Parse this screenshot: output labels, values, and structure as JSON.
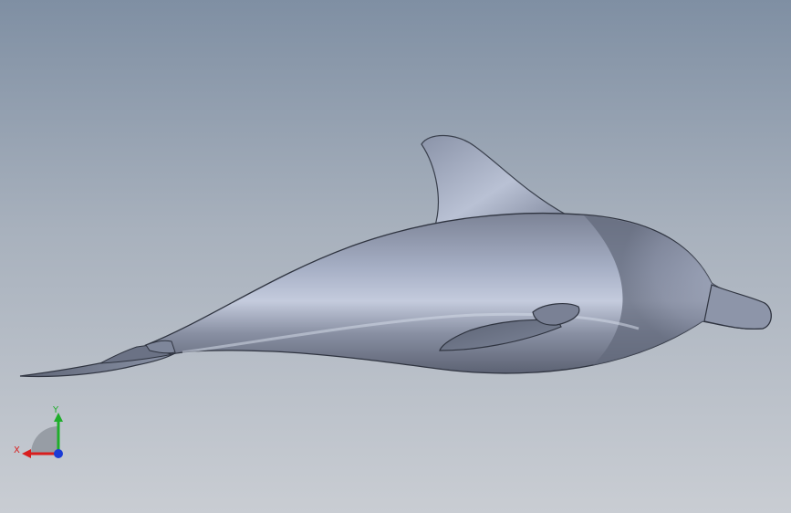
{
  "viewport": {
    "background_top": "#7f8fa3",
    "background_bottom": "#c9cdd3"
  },
  "model": {
    "name": "dolphin",
    "body_color": "#8e96a8",
    "edge_color": "#2f3440"
  },
  "triad": {
    "x_label": "X",
    "y_label": "Y",
    "x_color": "#d81e1e",
    "y_color": "#1fae2b",
    "z_color": "#1a3bd6"
  }
}
